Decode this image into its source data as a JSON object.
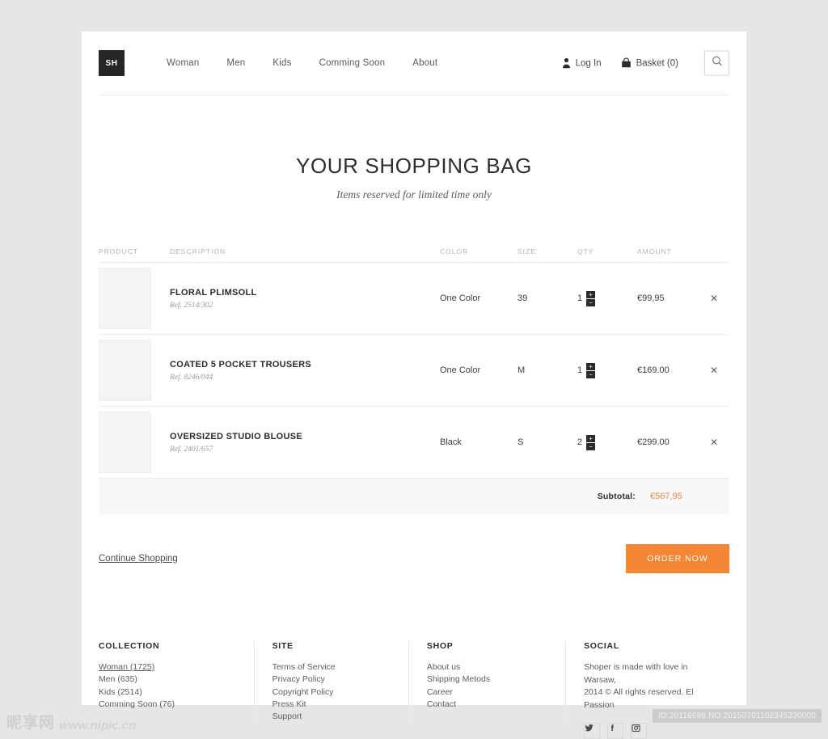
{
  "header": {
    "logo_text": "SH",
    "nav": [
      {
        "label": "Woman"
      },
      {
        "label": "Men"
      },
      {
        "label": "Kids"
      },
      {
        "label": "Comming Soon"
      },
      {
        "label": "About"
      }
    ],
    "login_label": "Log In",
    "basket_label": "Basket (0)",
    "search_placeholder": "Search"
  },
  "main": {
    "title": "YOUR SHOPPING BAG",
    "subtitle": "Items reserved for limited time only",
    "columns": {
      "product": "PRODUCT",
      "description": "DESCRIPTION",
      "color": "COLOR",
      "size": "SIZE",
      "qty": "QTY",
      "amount": "AMOUNT"
    },
    "items": [
      {
        "name": "FLORAL PLIMSOLL",
        "ref": "Ref. 2514/302",
        "color": "One Color",
        "size": "39",
        "qty": "1",
        "amount": "€99,95",
        "plus": "+",
        "minus": "−",
        "remove": "✕"
      },
      {
        "name": "COATED 5 POCKET TROUSERS",
        "ref": "Ref. 8246/044",
        "color": "One Color",
        "size": "M",
        "qty": "1",
        "amount": "€169.00",
        "plus": "+",
        "minus": "−",
        "remove": "✕"
      },
      {
        "name": "OVERSIZED STUDIO BLOUSE",
        "ref": "Ref. 2401/657",
        "color": "Black",
        "size": "S",
        "qty": "2",
        "amount": "€299.00",
        "plus": "+",
        "minus": "−",
        "remove": "✕"
      }
    ],
    "subtotal_label": "Subtotal:",
    "subtotal_value": "€567,95",
    "continue_label": "Continue Shopping",
    "order_label": "ORDER NOW"
  },
  "footer": {
    "collection": {
      "heading": "COLLECTION",
      "links": [
        {
          "label": "Woman (1725)",
          "active": true
        },
        {
          "label": "Men (635)",
          "active": false
        },
        {
          "label": "Kids (2514)",
          "active": false
        },
        {
          "label": "Comming Soon (76)",
          "active": false
        }
      ]
    },
    "site": {
      "heading": "SITE",
      "links": [
        {
          "label": "Terms of Service"
        },
        {
          "label": "Privacy Policy"
        },
        {
          "label": "Copyright Policy"
        },
        {
          "label": "Press Kit"
        },
        {
          "label": "Support"
        }
      ]
    },
    "shop": {
      "heading": "SHOP",
      "links": [
        {
          "label": "About us"
        },
        {
          "label": "Shipping Metods"
        },
        {
          "label": "Career"
        },
        {
          "label": "Contact"
        }
      ]
    },
    "social": {
      "heading": "SOCIAL",
      "line1": "Shoper is made with love in Warsaw,",
      "line2": "2014 © All rights reserved. El Passion"
    }
  },
  "watermark": {
    "cn_text": "昵享网",
    "url": "www.nipic.cn",
    "id_text": "ID:20116698 NO:20150701102345330000"
  },
  "colors": {
    "accent_orange": "#f58634",
    "subtotal_orange": "#f0843c",
    "logo_bg": "#262626",
    "page_bg": "#e6e6e6"
  }
}
